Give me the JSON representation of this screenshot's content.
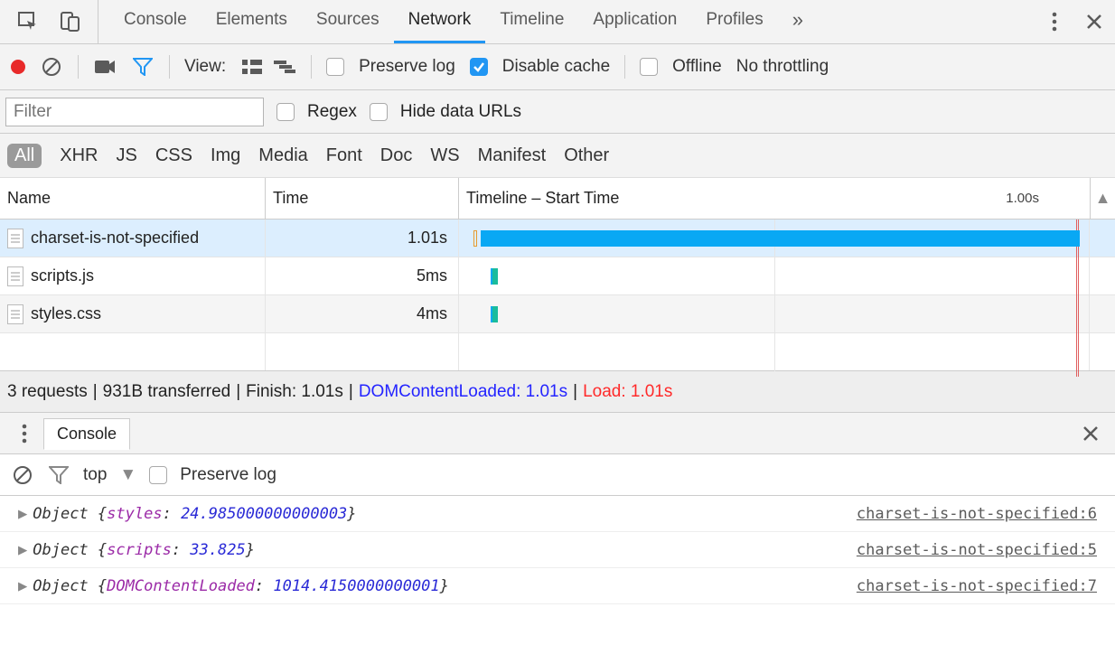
{
  "tabs": {
    "console": "Console",
    "elements": "Elements",
    "sources": "Sources",
    "network": "Network",
    "timeline": "Timeline",
    "application": "Application",
    "profiles": "Profiles",
    "active": "network"
  },
  "toolbar": {
    "view_label": "View:",
    "preserve_log": "Preserve log",
    "disable_cache": "Disable cache",
    "offline": "Offline",
    "throttling": "No throttling",
    "preserve_log_checked": false,
    "disable_cache_checked": true,
    "offline_checked": false
  },
  "filterbar": {
    "placeholder": "Filter",
    "value": "",
    "regex": "Regex",
    "hide_data_urls": "Hide data URLs",
    "regex_checked": false,
    "hide_data_urls_checked": false
  },
  "chips": {
    "all": "All",
    "xhr": "XHR",
    "js": "JS",
    "css": "CSS",
    "img": "Img",
    "media": "Media",
    "font": "Font",
    "doc": "Doc",
    "ws": "WS",
    "manifest": "Manifest",
    "other": "Other",
    "active": "all"
  },
  "table": {
    "headers": {
      "name": "Name",
      "time": "Time",
      "timeline": "Timeline – Start Time"
    },
    "timeline_tick": "1.00s",
    "rows": [
      {
        "name": "charset-is-not-specified",
        "time": "1.01s",
        "selected": true,
        "bar": {
          "left_pct": 3.5,
          "width_pct": 95
        },
        "tiny": null
      },
      {
        "name": "scripts.js",
        "time": "5ms",
        "selected": false,
        "bar": null,
        "tiny": {
          "left_pct": 5.0
        }
      },
      {
        "name": "styles.css",
        "time": "4ms",
        "selected": false,
        "bar": null,
        "tiny": {
          "left_pct": 5.0
        }
      }
    ]
  },
  "summary": {
    "requests": "3 requests",
    "transferred": "931B transferred",
    "finish": "Finish: 1.01s",
    "dcl": "DOMContentLoaded: 1.01s",
    "load": "Load: 1.01s"
  },
  "drawer": {
    "tab": "Console",
    "context": "top",
    "preserve_log": "Preserve log",
    "preserve_log_checked": false
  },
  "logs": [
    {
      "object": "Object",
      "key": "styles",
      "value": "24.985000000000003",
      "source": "charset-is-not-specified:6"
    },
    {
      "object": "Object",
      "key": "scripts",
      "value": "33.825",
      "source": "charset-is-not-specified:5"
    },
    {
      "object": "Object",
      "key": "DOMContentLoaded",
      "value": "1014.4150000000001",
      "source": "charset-is-not-specified:7"
    }
  ]
}
